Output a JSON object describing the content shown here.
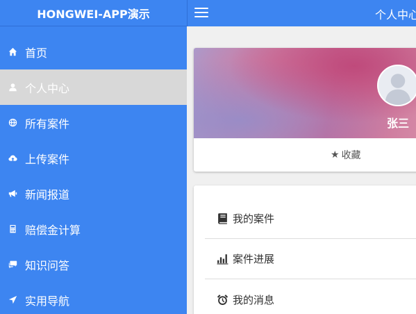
{
  "sidebar": {
    "title": "HONGWEI-APP演示",
    "items": [
      {
        "label": "首页",
        "icon": "home-icon"
      },
      {
        "label": "个人中心",
        "icon": "user-icon",
        "active": true
      },
      {
        "label": "所有案件",
        "icon": "globe-icon"
      },
      {
        "label": "上传案件",
        "icon": "cloud-upload-icon"
      },
      {
        "label": "新闻报道",
        "icon": "bullhorn-icon"
      },
      {
        "label": "赔偿金计算",
        "icon": "calculator-icon"
      },
      {
        "label": "知识问答",
        "icon": "chat-icon"
      },
      {
        "label": "实用导航",
        "icon": "navigation-icon"
      }
    ]
  },
  "topbar": {
    "title": "个人中心"
  },
  "profile": {
    "name": "张三",
    "favorite_label": "收藏"
  },
  "menu": [
    {
      "label": "我的案件",
      "icon": "book-icon"
    },
    {
      "label": "案件进展",
      "icon": "bar-chart-icon"
    },
    {
      "label": "我的消息",
      "icon": "alarm-clock-icon"
    }
  ],
  "colors": {
    "primary": "#3d85f1",
    "active_item": "#d8d8d8",
    "page_bg": "#f0f0f0"
  }
}
